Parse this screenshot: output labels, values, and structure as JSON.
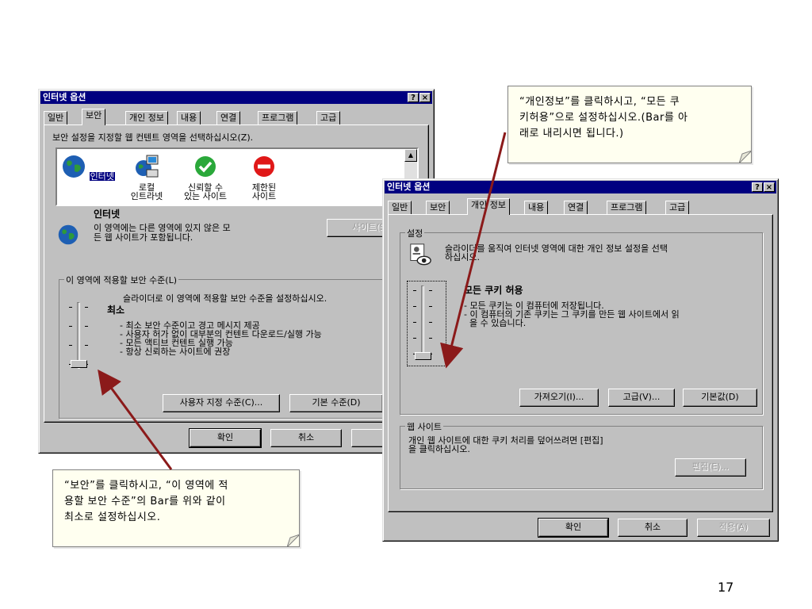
{
  "win1": {
    "title": "인터넷 옵션",
    "help_btn": "?",
    "close_btn": "×",
    "tabs": [
      "일반",
      "보안",
      "개인 정보",
      "내용",
      "연결",
      "프로그램",
      "고급"
    ],
    "instruction": "보안 설정을 지정할 웹 컨텐트 영역을 선택하십시오(Z).",
    "zones": [
      "인터넷",
      "로컬\n인트라넷",
      "신뢰할 수\n있는 사이트",
      "제한된\n사이트"
    ],
    "zone_title": "인터넷",
    "zone_desc_1": "이 영역에는 다른 영역에 있지 않은 모",
    "zone_desc_2": "든 웹 사이트가 포함됩니다.",
    "sites_btn": "사이트(S)",
    "group_label": "이 영역에 적용할 보안 수준(L)",
    "slider_hint": "슬라이더로 이 영역에 적용할 보안 수준을 설정하십시오.",
    "level_name": "최소",
    "level_items": [
      "- 최소 보안 수준이고 경고 메시지 제공",
      "- 사용자 허가 없이 대부분의 컨텐트 다운로드/실행 가능",
      "- 모든 액티브 컨텐트 실행 가능",
      "- 항상 신뢰하는 사이트에 권장"
    ],
    "custom_level_btn": "사용자 지정 수준(C)...",
    "default_level_btn": "기본 수준(D)",
    "ok_btn": "확인",
    "cancel_btn": "취소",
    "apply_btn": "적"
  },
  "win2": {
    "title": "인터넷 옵션",
    "help_btn": "?",
    "close_btn": "×",
    "tabs": [
      "일반",
      "보안",
      "개인 정보",
      "내용",
      "연결",
      "프로그램",
      "고급"
    ],
    "settings_label": "설정",
    "slider_hint_1": "슬라이더를 움직여 인터넷 영역에 대한 개인 정보 설정을 선택",
    "slider_hint_2": "하십시오.",
    "level_name": "모든 쿠키 허용",
    "level_items": [
      "- 모든 쿠키는 이 컴퓨터에 저장됩니다.",
      "- 이 컴퓨터의 기존 쿠키는 그 쿠키를 만든 웹 사이트에서 읽",
      "  을 수 있습니다."
    ],
    "import_btn": "가져오기(I)...",
    "advanced_btn": "고급(V)...",
    "default_btn": "기본값(D)",
    "websites_label": "웹 사이트",
    "websites_desc_1": "개인 웹 사이트에 대한 쿠키 처리를 덮어쓰려면 [편집]",
    "websites_desc_2": "을 클릭하십시오.",
    "edit_btn": "편집(E)...",
    "ok_btn": "확인",
    "cancel_btn": "취소",
    "apply_btn": "적용(A)"
  },
  "note_top": {
    "line1": "“개인정보”를 클릭하시고, “모든 쿠",
    "line2": "키허용”으로 설정하십시오.(Bar를 아",
    "line3": "래로 내리시면 됩니다.)"
  },
  "note_bottom": {
    "line1": "“보안”를 클릭하시고, “이 영역에 적",
    "line2": "용할 보안 수준”의 Bar를 위와 같이",
    "line3": "최소로 설정하십시오."
  },
  "page_number": "17",
  "colors": {
    "titlebar": "#000080",
    "arrow": "#8b1a1a",
    "note_bg": "#fffff0"
  }
}
